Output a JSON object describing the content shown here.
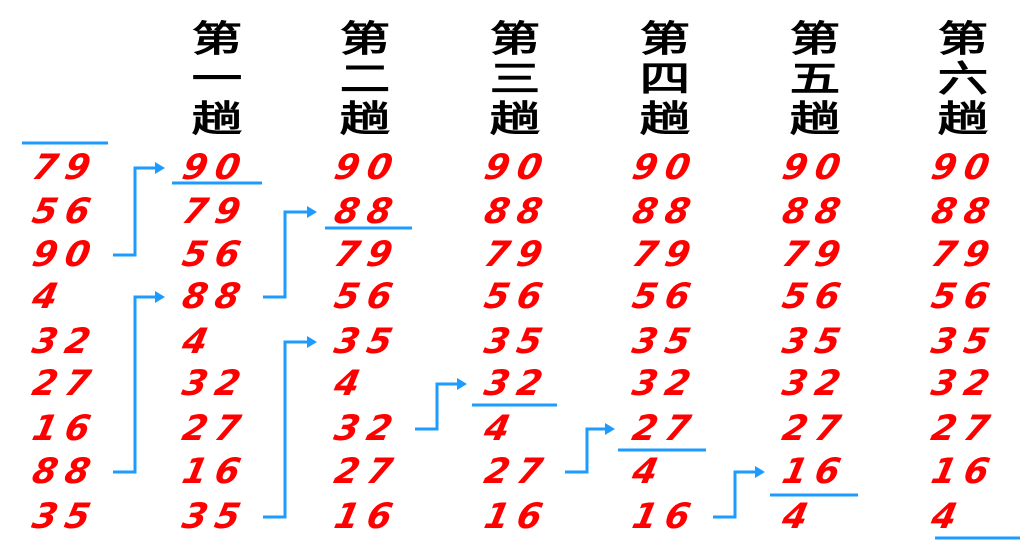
{
  "colors": {
    "value_text": "#ff0000",
    "marker": "#1e9bff",
    "header_text": "#000000"
  },
  "columns": [
    {
      "values": [
        79,
        56,
        90,
        4,
        32,
        27,
        16,
        88,
        35
      ]
    },
    {
      "header": "第一趟",
      "values": [
        90,
        79,
        56,
        88,
        4,
        32,
        27,
        16,
        35
      ]
    },
    {
      "header": "第二趟",
      "values": [
        90,
        88,
        79,
        56,
        35,
        4,
        32,
        27,
        16
      ]
    },
    {
      "header": "第三趟",
      "values": [
        90,
        88,
        79,
        56,
        35,
        32,
        4,
        27,
        16
      ]
    },
    {
      "header": "第四趟",
      "values": [
        90,
        88,
        79,
        56,
        35,
        32,
        27,
        4,
        16
      ]
    },
    {
      "header": "第五趟",
      "values": [
        90,
        88,
        79,
        56,
        35,
        32,
        27,
        16,
        4
      ]
    },
    {
      "header": "第六趟",
      "values": [
        90,
        88,
        79,
        56,
        35,
        32,
        27,
        16,
        4
      ]
    }
  ]
}
